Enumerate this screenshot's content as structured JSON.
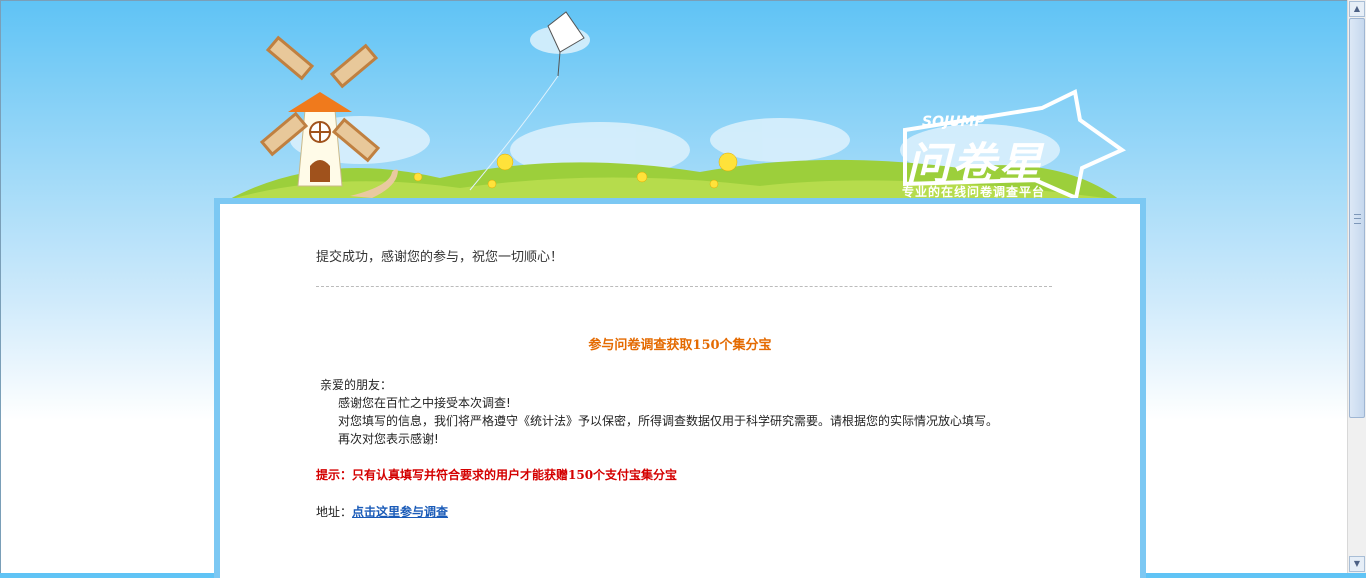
{
  "header": {
    "logo_en": "SOJUMP",
    "logo_cn": "问卷星",
    "slogan": "专业的在线问卷调查平台"
  },
  "content": {
    "success_message": "提交成功，感谢您的参与，祝您一切顺心！",
    "promo_title": "参与问卷调查获取150个集分宝",
    "greeting": "亲爱的朋友：",
    "lines": [
      "感谢您在百忙之中接受本次调查!",
      "对您填写的信息，我们将严格遵守《统计法》予以保密，所得调查数据仅用于科学研究需要。请根据您的实际情况放心填写。",
      "再次对您表示感谢!"
    ],
    "tip": "提示：只有认真填写并符合要求的用户才能获赠150个支付宝集分宝",
    "address_label": "地址：",
    "address_link": "点击这里参与调查"
  },
  "colors": {
    "sky_top": "#5fc3f5",
    "panel_border": "#7cc8f3",
    "promo_title": "#e46a00",
    "tip": "#d40000",
    "link": "#1a5bb8"
  }
}
